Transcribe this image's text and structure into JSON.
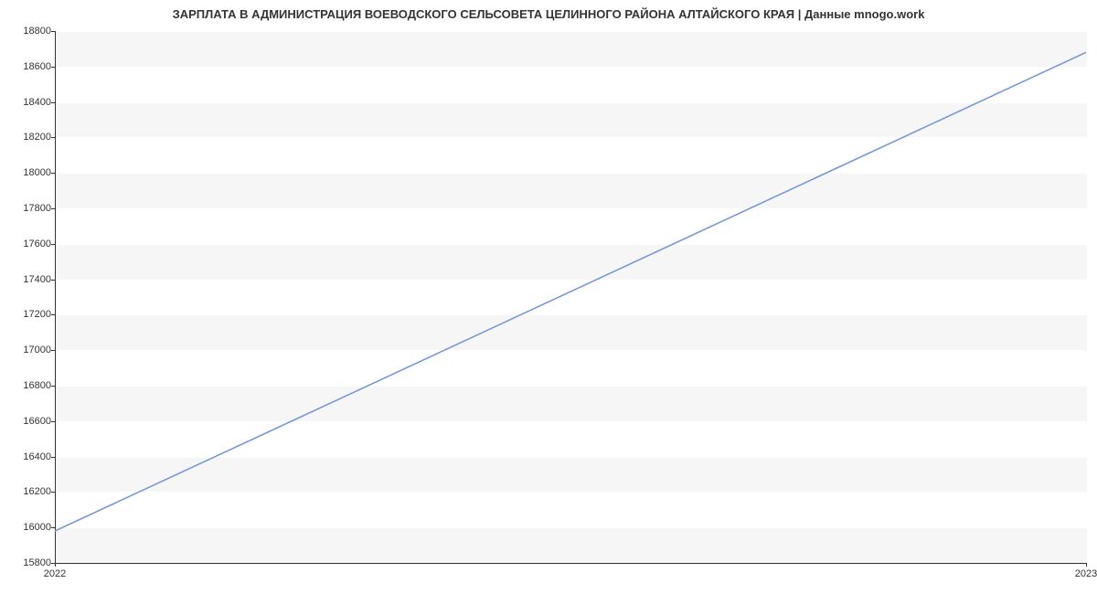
{
  "chart_data": {
    "type": "line",
    "title": "ЗАРПЛАТА В АДМИНИСТРАЦИЯ ВОЕВОДСКОГО СЕЛЬСОВЕТА ЦЕЛИННОГО РАЙОНА АЛТАЙСКОГО КРАЯ | Данные mnogo.work",
    "x": [
      "2022",
      "2023"
    ],
    "values": [
      15980,
      18680
    ],
    "xlabel": "",
    "ylabel": "",
    "ylim": [
      15800,
      18800
    ],
    "y_ticks": [
      15800,
      16000,
      16200,
      16400,
      16600,
      16800,
      17000,
      17200,
      17400,
      17600,
      17800,
      18000,
      18200,
      18400,
      18600,
      18800
    ],
    "x_ticks": [
      "2022",
      "2023"
    ],
    "line_color": "#6c95d9"
  }
}
